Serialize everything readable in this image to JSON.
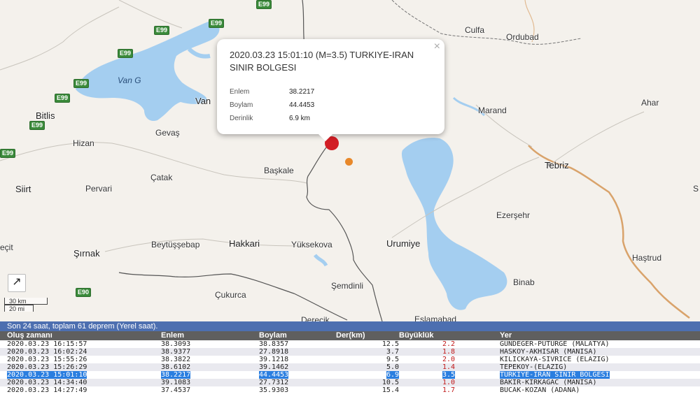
{
  "map": {
    "places": [
      {
        "name": "Culfa"
      },
      {
        "name": "Ordubad"
      },
      {
        "name": "Van"
      },
      {
        "name": "Marand"
      },
      {
        "name": "Ahar"
      },
      {
        "name": "Bitlis"
      },
      {
        "name": "Gevaş"
      },
      {
        "name": "Hizan"
      },
      {
        "name": "Başkale"
      },
      {
        "name": "Tebriz"
      },
      {
        "name": "Çatak"
      },
      {
        "name": "Siirt"
      },
      {
        "name": "Pervari"
      },
      {
        "name": "Ezerşehr"
      },
      {
        "name": "Urumiye"
      },
      {
        "name": "Hakkari"
      },
      {
        "name": "Beytüşşebap"
      },
      {
        "name": "Yüksekova"
      },
      {
        "name": "Şırnak"
      },
      {
        "name": "Haştrud"
      },
      {
        "name": "Binab"
      },
      {
        "name": "Şemdinli"
      },
      {
        "name": "Çukurca"
      },
      {
        "name": "Derecik"
      },
      {
        "name": "Eslamabad"
      },
      {
        "name": "eçit"
      },
      {
        "name": "S"
      }
    ],
    "lake_label": "Van G",
    "road_shields": [
      "E99",
      "E99",
      "E99",
      "E99",
      "E99",
      "E99",
      "E99",
      "E99",
      "E90"
    ],
    "fullscreen_icon": "↗",
    "scale": {
      "km": "30 km",
      "mi": "20 mi"
    },
    "colors": {
      "water": "#a4cef0",
      "land": "#f4f1ec",
      "border": "#555555",
      "road_major": "#d9a36b"
    }
  },
  "popup": {
    "title": "2020.03.23 15:01:10 (M=3.5) TURKIYE-IRAN SINIR BOLGESI",
    "close_icon": "×",
    "fields": [
      {
        "label": "Enlem",
        "value": "38.2217"
      },
      {
        "label": "Boylam",
        "value": "44.4453"
      },
      {
        "label": "Derinlik",
        "value": "6.9 km"
      }
    ]
  },
  "summary": "Son 24 saat, toplam 61 deprem (Yerel saat).",
  "table": {
    "headers": {
      "time": "Oluş zamanı",
      "lat": "Enlem",
      "lon": "Boylam",
      "depth": "Der(km)",
      "mag": "Büyüklük",
      "loc": "Yer"
    },
    "rows": [
      {
        "time": "2020.03.23 16:15:57",
        "lat": "38.3093",
        "lon": "38.8357",
        "depth": "12.5",
        "mag": "2.2",
        "loc": "GUNDEGER-PUTURGE (MALATYA)",
        "selected": false
      },
      {
        "time": "2020.03.23 16:02:24",
        "lat": "38.9377",
        "lon": "27.8918",
        "depth": "3.7",
        "mag": "1.8",
        "loc": "HASKOY-AKHISAR (MANISA)",
        "selected": false
      },
      {
        "time": "2020.03.23 15:55:26",
        "lat": "38.3822",
        "lon": "39.1218",
        "depth": "9.5",
        "mag": "2.0",
        "loc": "KILICKAYA-SIVRICE (ELAZIG)",
        "selected": false
      },
      {
        "time": "2020.03.23 15:26:29",
        "lat": "38.6102",
        "lon": "39.1462",
        "depth": "5.0",
        "mag": "1.4",
        "loc": "TEPEKOY-(ELAZIG)",
        "selected": false
      },
      {
        "time": "2020.03.23 15:01:10",
        "lat": "38.2217",
        "lon": "44.4453",
        "depth": "6.9",
        "mag": "3.5",
        "loc": "TURKIYE-IRAN SINIR BOLGESI",
        "selected": true
      },
      {
        "time": "2020.03.23 14:34:40",
        "lat": "39.1083",
        "lon": "27.7312",
        "depth": "10.5",
        "mag": "1.0",
        "loc": "BAKIR-KIRKAGAC (MANISA)",
        "selected": false
      },
      {
        "time": "2020.03.23 14:27:49",
        "lat": "37.4537",
        "lon": "35.9303",
        "depth": "15.4",
        "mag": "1.7",
        "loc": "BUCAK-KOZAN (ADANA)",
        "selected": false
      }
    ]
  }
}
